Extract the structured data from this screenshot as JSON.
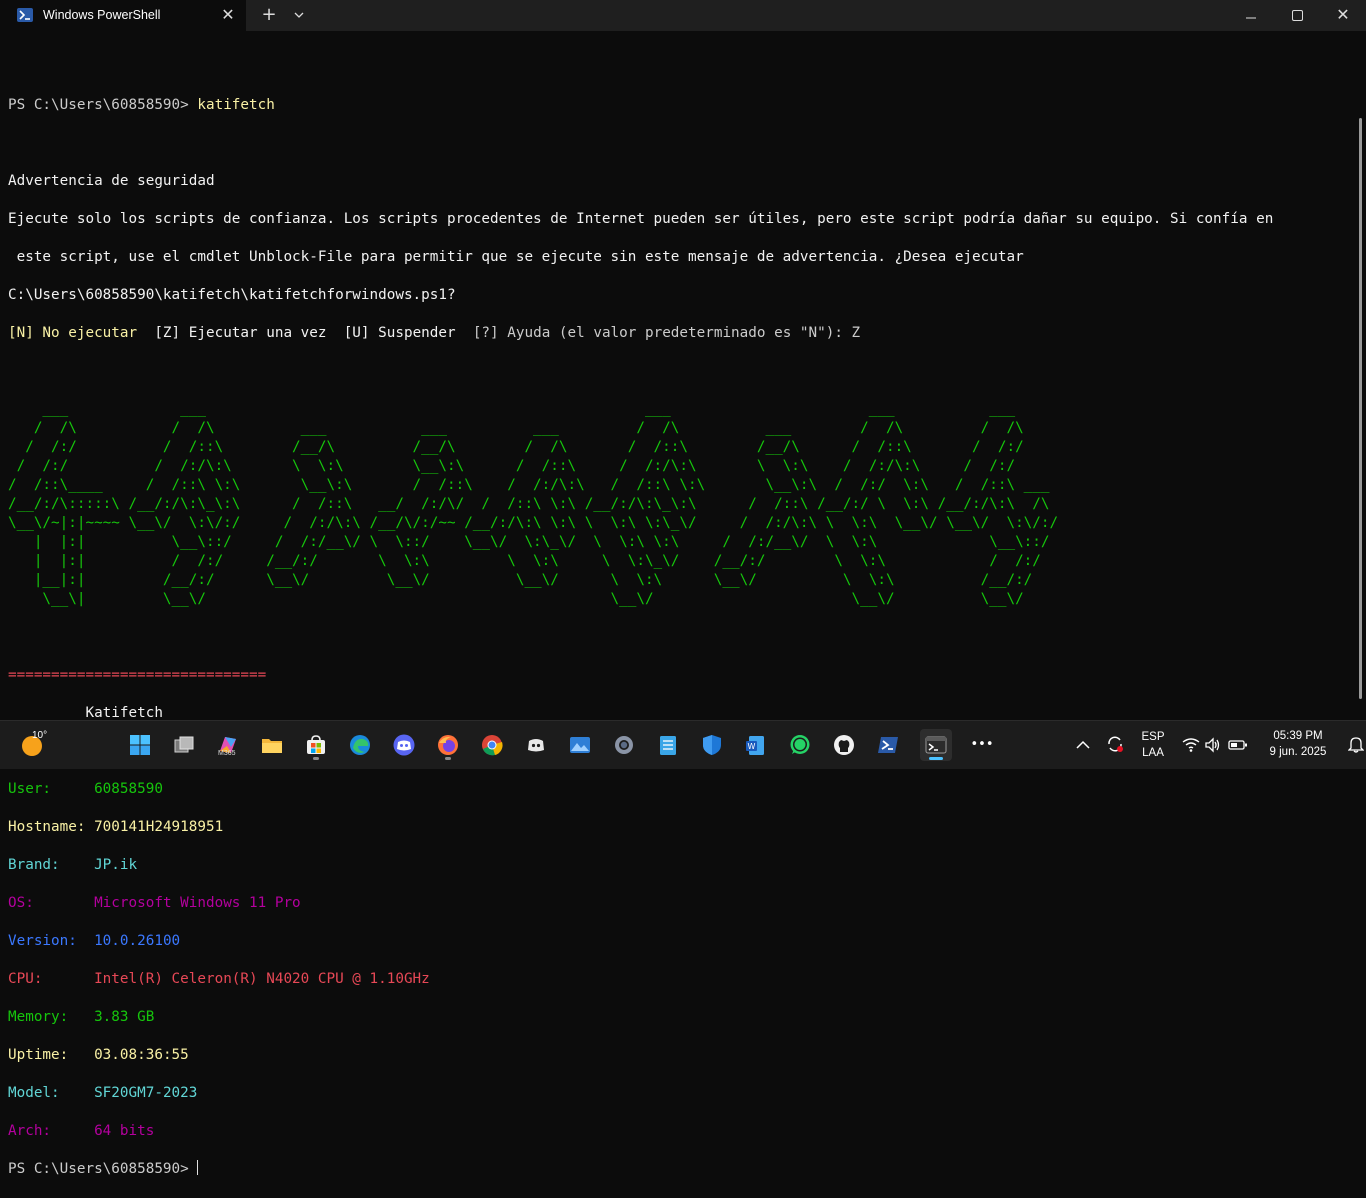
{
  "window": {
    "tab_title": "Windows PowerShell",
    "tab_close": "✕",
    "new_tab": "+",
    "dropdown": "⌄",
    "minimize": "—",
    "close": "✕"
  },
  "terminal": {
    "prompt_line": "PS C:\\Users\\60858590> ",
    "command": "katifetch",
    "warning_title": "Advertencia de seguridad",
    "warning_line1": "Ejecute solo los scripts de confianza. Los scripts procedentes de Internet pueden ser útiles, pero este script podría dañar su equipo. Si confía en",
    "warning_line2": " este script, use el cmdlet Unblock-File para permitir que se ejecute sin este mensaje de advertencia. ¿Desea ejecutar",
    "warning_line3": "C:\\Users\\60858590\\katifetch\\katifetchforwindows.ps1?",
    "choice_n": "[N] No ejecutar  ",
    "choice_z": "[Z] Ejecutar una vez  ",
    "choice_u": "[U] Suspender  ",
    "choice_help": "[?] Ayuda (el valor predeterminado es \"N\"): Z",
    "ascii_art": [
      "    ___             ___                                                   ___                       ___           ___",
      "   /  /\\           /  /\\          ___           ___          ___         /  /\\          ___        /  /\\         /  /\\",
      "  /  /:/          /  /::\\        /__/\\         /__/\\        /  /\\       /  /::\\        /__/\\      /  /::\\       /  /:/",
      " /  /:/          /  /:/\\:\\       \\  \\:\\        \\__\\:\\      /  /::\\     /  /:/\\:\\       \\  \\:\\    /  /:/\\:\\     /  /:/",
      "/  /::\\____     /  /::\\ \\:\\       \\__\\:\\       /  /::\\    /  /:/\\:\\   /  /::\\ \\:\\       \\__\\:\\  /  /:/  \\:\\   /  /::\\ ___",
      "/__/:/\\:::::\\ /__/:/\\:\\_\\:\\      /  /::\\   __/  /:/\\/  /  /::\\ \\:\\ /__/:/\\:\\_\\:\\      /  /::\\ /__/:/ \\  \\:\\ /__/:/\\:\\  /\\",
      "\\__\\/~|:|~~~~ \\__\\/  \\:\\/:/     /  /:/\\:\\ /__/\\/:/~~ /__/:/\\:\\ \\:\\ \\  \\:\\ \\:\\_\\/     /  /:/\\:\\ \\  \\:\\  \\__\\/ \\__\\/  \\:\\/:/",
      "   |  |:|          \\__\\::/     /  /:/__\\/ \\  \\::/    \\__\\/  \\:\\_\\/  \\  \\:\\ \\:\\     /  /:/__\\/  \\  \\:\\             \\__\\::/",
      "   |  |:|          /  /:/     /__/:/       \\  \\:\\         \\  \\:\\     \\  \\:\\_\\/    /__/:/        \\  \\:\\            /  /:/",
      "   |__|:|         /__/:/      \\__\\/         \\__\\/          \\__\\/      \\  \\:\\      \\__\\/          \\  \\:\\          /__/:/",
      "    \\__\\|         \\__\\/                                               \\__\\/                       \\__\\/          \\__\\/"
    ],
    "separator": "==============================",
    "info_title": "         Katifetch",
    "info": [
      {
        "label": "User:     ",
        "value": "60858590"
      },
      {
        "label": "Hostname: ",
        "value": "700141H24918951"
      },
      {
        "label": "Brand:    ",
        "value": "JP.ik"
      },
      {
        "label": "OS:       ",
        "value": "Microsoft Windows 11 Pro"
      },
      {
        "label": "Version:  ",
        "value": "10.0.26100"
      },
      {
        "label": "CPU:      ",
        "value": "Intel(R) Celeron(R) N4020 CPU @ 1.10GHz"
      },
      {
        "label": "Memory:   ",
        "value": "3.83 GB"
      },
      {
        "label": "Uptime:   ",
        "value": "03.08:36:55"
      },
      {
        "label": "Model:    ",
        "value": "SF20GM7-2023"
      },
      {
        "label": "Arch:     ",
        "value": "64 bits"
      }
    ],
    "final_prompt": "PS C:\\Users\\60858590> "
  },
  "taskbar": {
    "weather_temp": "10°",
    "m365_label": "M365",
    "overflow": "•••",
    "tray_chevron": "^",
    "lang_top": "ESP",
    "lang_bottom": "LAA",
    "time": "05:39 PM",
    "date": "9 jun. 2025",
    "icons": [
      "start-icon",
      "task-view-icon",
      "m365-copilot-icon",
      "file-explorer-icon",
      "store-icon",
      "edge-icon",
      "discord-icon",
      "firefox-icon",
      "chrome-icon",
      "discord-dark-icon",
      "photos-icon",
      "settings-icon",
      "notepad-icon",
      "defender-icon",
      "word-icon",
      "whatsapp-icon",
      "github-icon",
      "powershell-icon",
      "terminal-icon"
    ]
  },
  "colors": {
    "background": "#0c0c0c",
    "ascii_green": "#16c60c",
    "separator_red": "#e74856",
    "accent_blue": "#4cc2ff"
  }
}
